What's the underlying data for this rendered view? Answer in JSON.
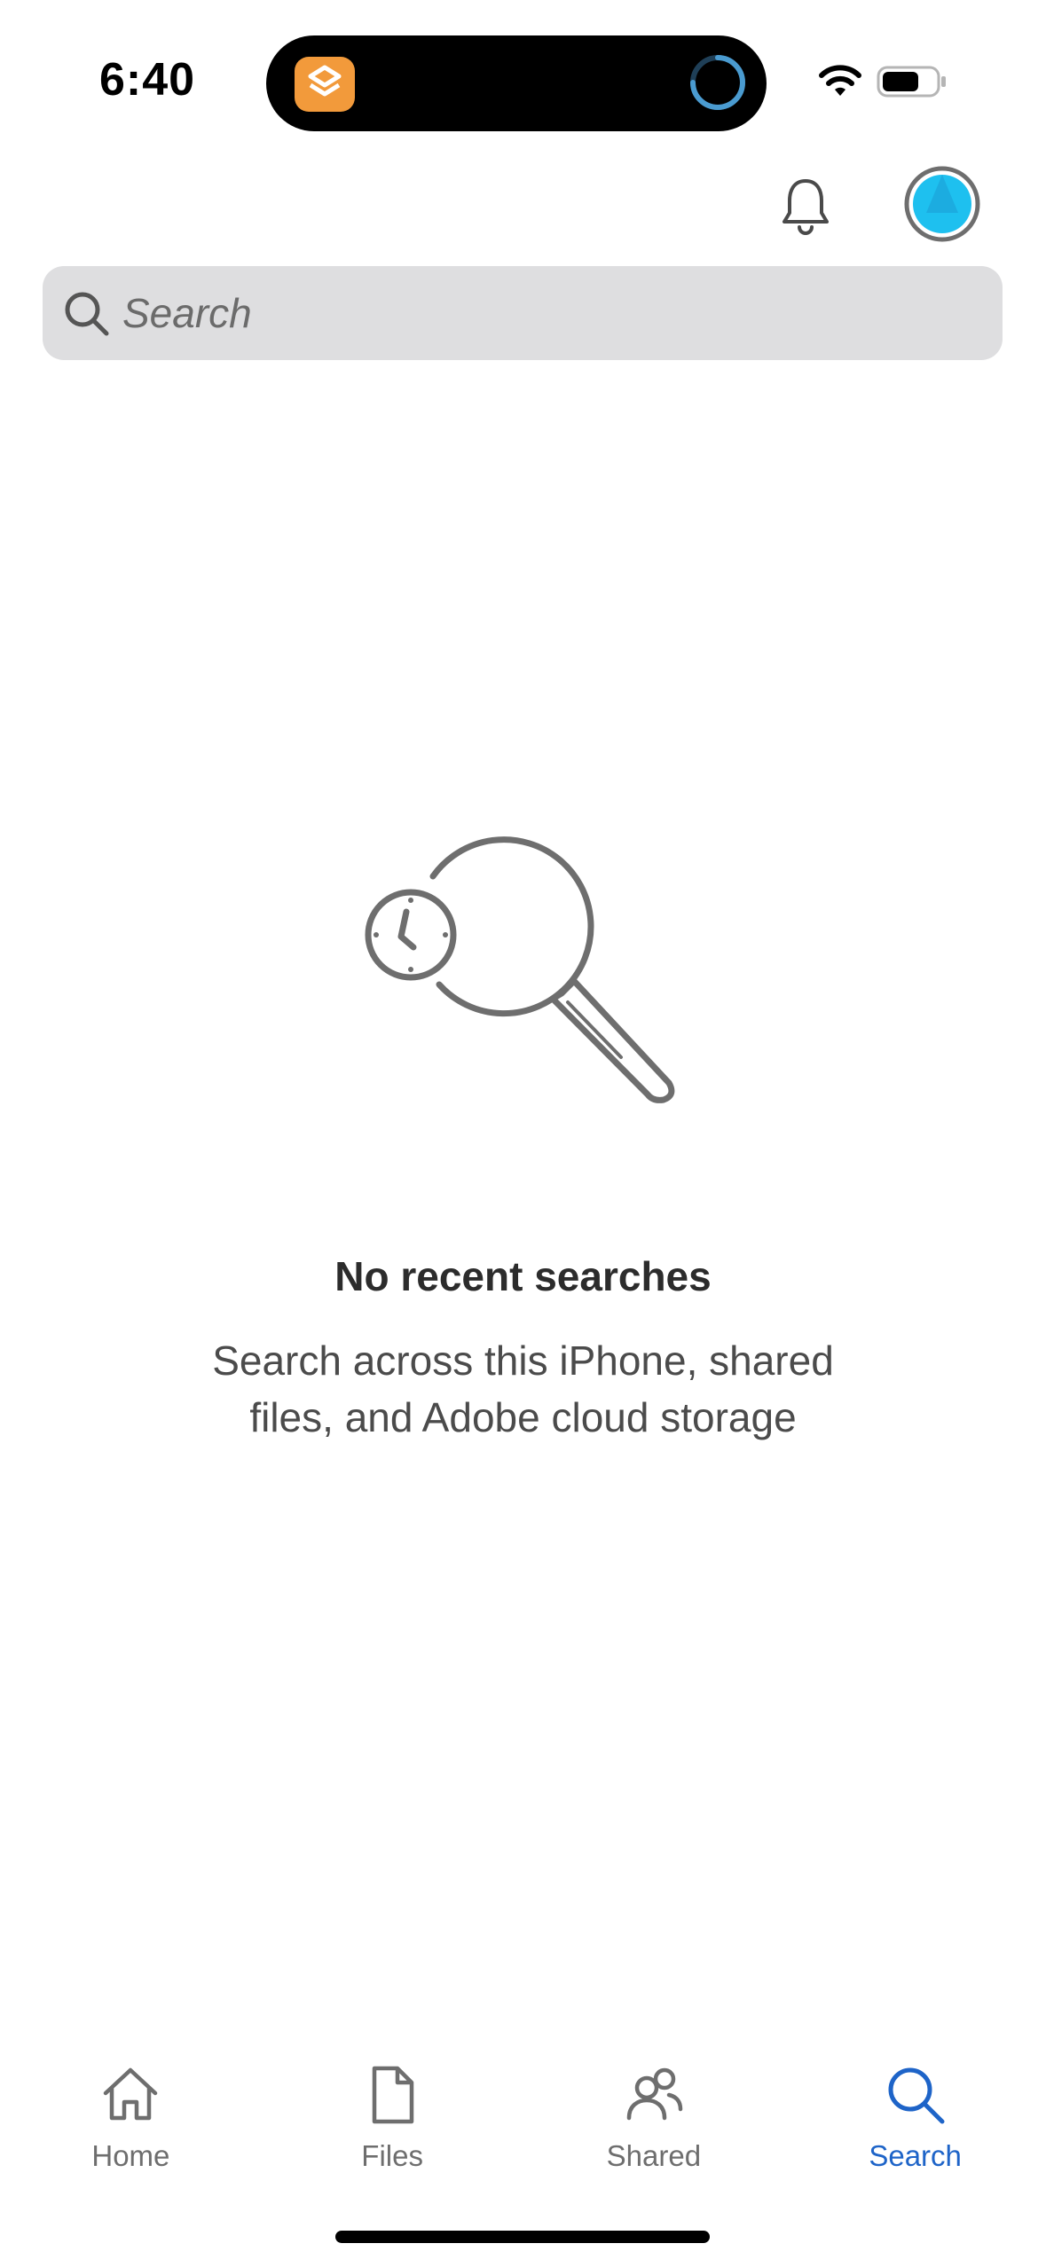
{
  "status_bar": {
    "time": "6:40",
    "island_app_icon": "shortcuts-app-icon",
    "activity_icon": "progress-spinner-icon",
    "wifi_icon": "wifi-icon",
    "battery_icon": "battery-icon",
    "battery_level": 0.65
  },
  "header": {
    "notifications_icon": "bell-icon",
    "avatar_icon": "avatar",
    "avatar_color": "#1ec0ef"
  },
  "search": {
    "placeholder": "Search",
    "value": "",
    "icon": "search-icon"
  },
  "empty_state": {
    "icon": "recent-search-illustration-icon",
    "title": "No recent searches",
    "subtitle": "Search across this iPhone, shared files, and Adobe cloud storage"
  },
  "tabs": [
    {
      "label": "Home",
      "icon": "home-icon",
      "active": false
    },
    {
      "label": "Files",
      "icon": "file-icon",
      "active": false
    },
    {
      "label": "Shared",
      "icon": "shared-users-icon",
      "active": false
    },
    {
      "label": "Search",
      "icon": "search-icon",
      "active": true
    }
  ],
  "colors": {
    "accent": "#1e64c8",
    "search_bar_bg": "#dedee0",
    "icon_gray": "#6e6e6e"
  }
}
